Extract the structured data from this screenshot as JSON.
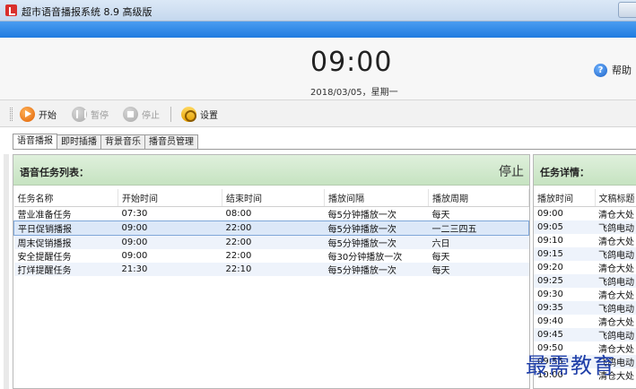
{
  "window": {
    "title": "超市语音播报系统 8.9 高级版"
  },
  "clock": {
    "time": "09:00",
    "date": "2018/03/05，星期一"
  },
  "help": {
    "label": "帮助",
    "icon": "question-icon"
  },
  "toolbar": {
    "start_label": "开始",
    "pause_label": "暂停",
    "stop_label": "停止",
    "settings_label": "设置"
  },
  "tabs": [
    "语音播报",
    "即时插播",
    "背景音乐",
    "播音员管理"
  ],
  "task_list": {
    "heading": "语音任务列表：",
    "status": "停止",
    "columns": [
      "任务名称",
      "开始时间",
      "结束时间",
      "播放间隔",
      "播放周期"
    ],
    "rows": [
      [
        "营业准备任务",
        "07:30",
        "08:00",
        "每5分钟播放一次",
        "每天"
      ],
      [
        "平日促销播报",
        "09:00",
        "22:00",
        "每5分钟播放一次",
        "一二三四五"
      ],
      [
        "周末促销播报",
        "09:00",
        "22:00",
        "每5分钟播放一次",
        "六日"
      ],
      [
        "安全提醒任务",
        "09:00",
        "22:00",
        "每30分钟播放一次",
        "每天"
      ],
      [
        "打烊提醒任务",
        "21:30",
        "22:10",
        "每5分钟播放一次",
        "每天"
      ]
    ]
  },
  "task_detail": {
    "heading": "任务详情：",
    "columns": [
      "播放时间",
      "文稿标题"
    ],
    "rows": [
      [
        "09:00",
        "清仓大处"
      ],
      [
        "09:05",
        "飞鸽电动"
      ],
      [
        "09:10",
        "清仓大处"
      ],
      [
        "09:15",
        "飞鸽电动"
      ],
      [
        "09:20",
        "清仓大处"
      ],
      [
        "09:25",
        "飞鸽电动"
      ],
      [
        "09:30",
        "清仓大处"
      ],
      [
        "09:35",
        "飞鸽电动"
      ],
      [
        "09:40",
        "清仓大处"
      ],
      [
        "09:45",
        "飞鸽电动"
      ],
      [
        "09:50",
        "清仓大处"
      ],
      [
        "09:55",
        "飞鸽电动"
      ],
      [
        "10:00",
        "清仓大处"
      ]
    ]
  },
  "watermark": "最需教育",
  "colors": {
    "accent_blue": "#1f7be0",
    "panel_green": "#c6e3c1",
    "play_orange": "#e05f00"
  }
}
